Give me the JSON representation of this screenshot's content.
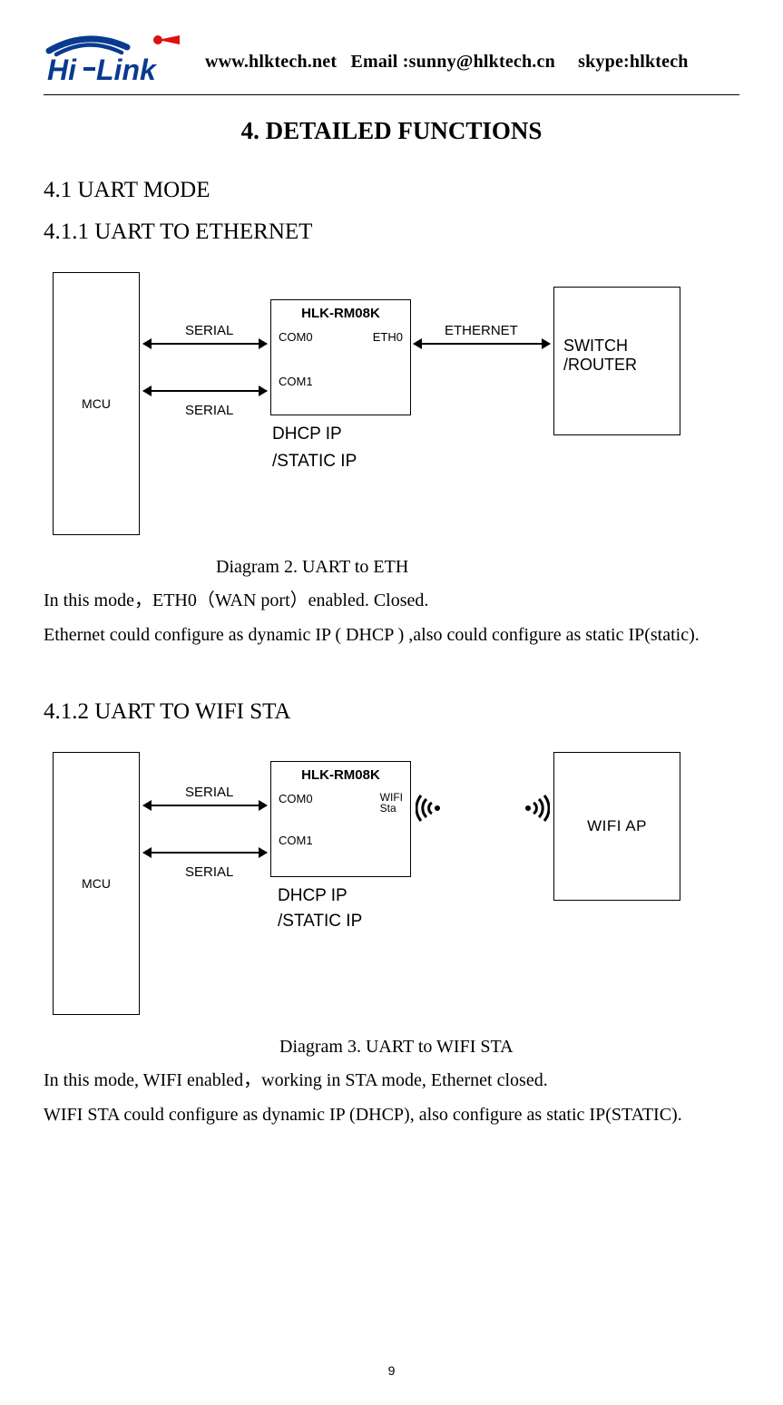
{
  "header": {
    "website": "www.hlktech.net",
    "email": "Email :sunny@hlktech.cn",
    "skype": "skype:hlktech",
    "logo_text_hi": "Hi",
    "logo_text_link": "Link"
  },
  "title": "4. DETAILED FUNCTIONS",
  "section_4_1": "4.1 UART MODE",
  "section_4_1_1": "4.1.1 UART TO ETHERNET",
  "diagram1": {
    "mcu": "MCU",
    "center_title": "HLK-RM08K",
    "com0": "COM0",
    "eth0": "ETH0",
    "com1": "COM1",
    "dhcp": "DHCP IP",
    "static": "/STATIC IP",
    "serial1": "SERIAL",
    "serial2": "SERIAL",
    "ethernet": "ETHERNET",
    "right_l1": "SWITCH",
    "right_l2": "/ROUTER"
  },
  "caption1": "Diagram 2. UART to ETH",
  "para1a": "In this mode，ETH0（WAN port）enabled.    Closed.",
  "para1b": "Ethernet could configure as dynamic IP ( DHCP ) ,also could configure as static IP(static).",
  "section_4_1_2": "4.1.2 UART TO WIFI STA",
  "diagram2": {
    "mcu": "MCU",
    "center_title": "HLK-RM08K",
    "com0": "COM0",
    "wifi": "WIFI",
    "sta": "Sta",
    "com1": "COM1",
    "dhcp": "DHCP IP",
    "static": "/STATIC IP",
    "serial1": "SERIAL",
    "serial2": "SERIAL",
    "right": "WIFI AP"
  },
  "caption2": "Diagram 3. UART to WIFI STA",
  "para2a": "In this mode, WIFI enabled，working in STA mode, Ethernet closed.",
  "para2b": "WIFI STA could configure as dynamic IP (DHCP), also configure as static IP(STATIC).",
  "page_number": "9"
}
